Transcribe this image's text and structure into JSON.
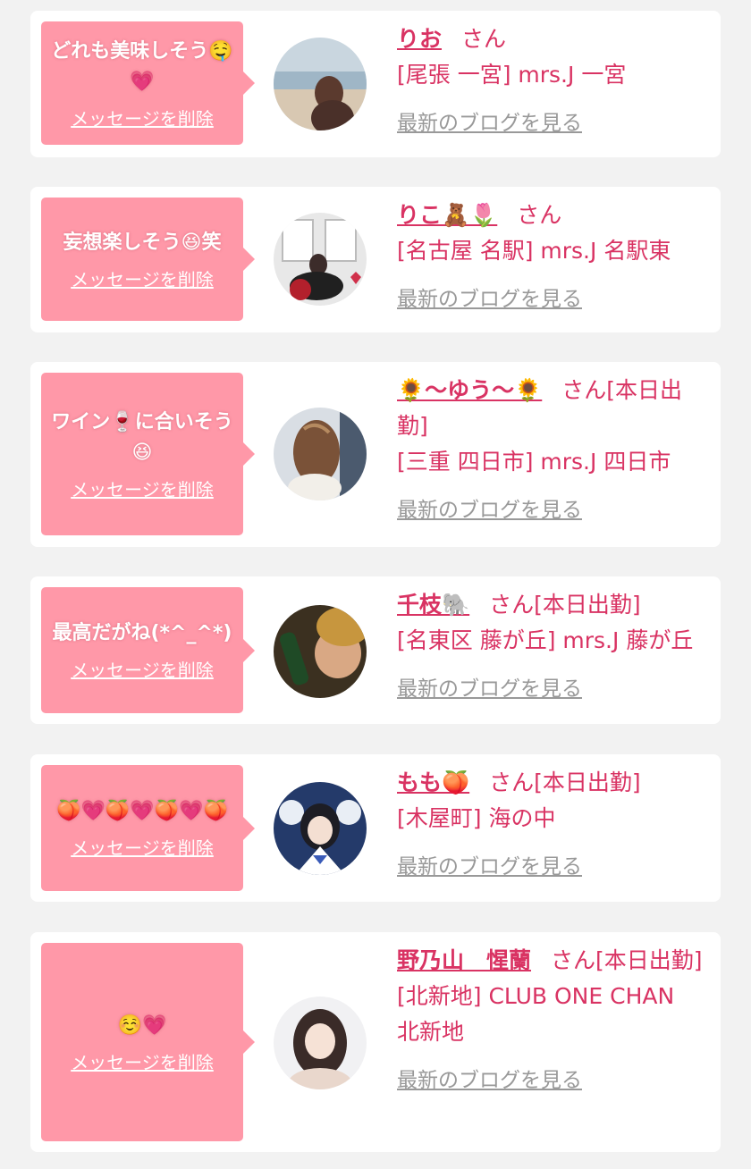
{
  "items": [
    {
      "message": "どれも美味しそう🤤💗",
      "delete_label": "メッセージを削除",
      "name": "りお",
      "san": "さん",
      "store": "[尾張 一宮] mrs.J 一宮",
      "blog_link": "最新のブログを見る"
    },
    {
      "message": "妄想楽しそう😆笑",
      "delete_label": "メッセージを削除",
      "name": "りこ🧸🌷",
      "san": "さん",
      "store": "[名古屋 名駅] mrs.J 名駅東",
      "blog_link": "最新のブログを見る"
    },
    {
      "message": "ワイン🍷に合いそう😆",
      "delete_label": "メッセージを削除",
      "name": "🌻〜ゆう〜🌻",
      "san": "さん[本日出勤]",
      "store": "[三重 四日市] mrs.J 四日市",
      "blog_link": "最新のブログを見る"
    },
    {
      "message": "最高だがね(*^_^*)",
      "delete_label": "メッセージを削除",
      "name": "千枝🐘",
      "san": "さん[本日出勤]",
      "store": "[名東区 藤が丘] mrs.J 藤が丘",
      "blog_link": "最新のブログを見る"
    },
    {
      "message": "🍑💗🍑💗🍑💗🍑",
      "delete_label": "メッセージを削除",
      "name": "もも🍑",
      "san": "さん[本日出勤]",
      "store": "[木屋町] 海の中",
      "blog_link": "最新のブログを見る"
    },
    {
      "message": "☺️💗",
      "delete_label": "メッセージを削除",
      "name": "野乃山　惺蘭",
      "san": "さん[本日出勤]",
      "store": "[北新地] CLUB ONE CHAN　北新地",
      "blog_link": "最新のブログを見る"
    }
  ],
  "colors": {
    "page_bg": "#f2f2f2",
    "card_bg": "#ffffff",
    "bubble_bg": "#ff98a8",
    "name_text": "#d93363",
    "link_gray": "#999999"
  }
}
